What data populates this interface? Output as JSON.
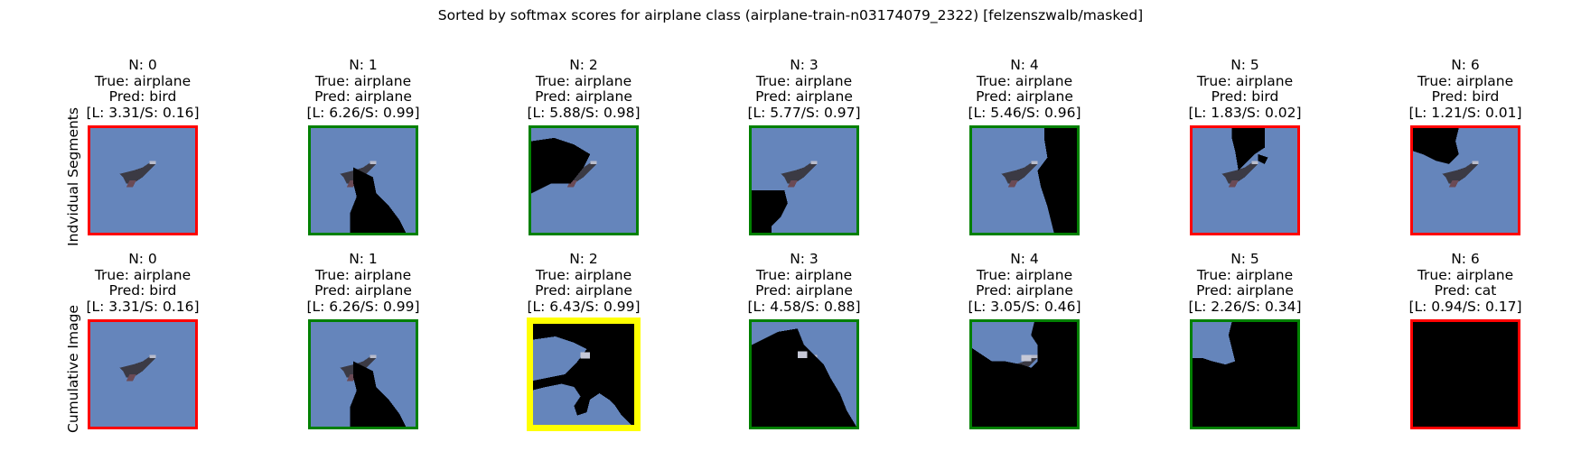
{
  "title": "Sorted by softmax scores for airplane class (airplane-train-n03174079_2322) [felzenszwalb/masked]",
  "row_labels": [
    "Indvidual Segments",
    "Cumulative Image"
  ],
  "colors": {
    "correct_border": "#008000",
    "incorrect_border": "#ff0000",
    "highlight_border": "#ffff00",
    "sky": "#6585bb",
    "mask": "#000000"
  },
  "chart_data": {
    "type": "image-grid",
    "rows": [
      {
        "label": "Indvidual Segments",
        "panels": [
          {
            "n": "N: 0",
            "true": "True: airplane",
            "pred": "Pred: bird",
            "score": "[L: 3.31/S: 0.16]",
            "correct": false
          },
          {
            "n": "N: 1",
            "true": "True: airplane",
            "pred": "Pred: airplane",
            "score": "[L: 6.26/S: 0.99]",
            "correct": true
          },
          {
            "n": "N: 2",
            "true": "True: airplane",
            "pred": "Pred: airplane",
            "score": "[L: 5.88/S: 0.98]",
            "correct": true
          },
          {
            "n": "N: 3",
            "true": "True: airplane",
            "pred": "Pred: airplane",
            "score": "[L: 5.77/S: 0.97]",
            "correct": true
          },
          {
            "n": "N: 4",
            "true": "True: airplane",
            "pred": "Pred: airplane",
            "score": "[L: 5.46/S: 0.96]",
            "correct": true
          },
          {
            "n": "N: 5",
            "true": "True: airplane",
            "pred": "Pred: bird",
            "score": "[L: 1.83/S: 0.02]",
            "correct": false
          },
          {
            "n": "N: 6",
            "true": "True: airplane",
            "pred": "Pred: bird",
            "score": "[L: 1.21/S: 0.01]",
            "correct": false
          }
        ]
      },
      {
        "label": "Cumulative Image",
        "panels": [
          {
            "n": "N: 0",
            "true": "True: airplane",
            "pred": "Pred: bird",
            "score": "[L: 3.31/S: 0.16]",
            "correct": false
          },
          {
            "n": "N: 1",
            "true": "True: airplane",
            "pred": "Pred: airplane",
            "score": "[L: 6.26/S: 0.99]",
            "correct": true
          },
          {
            "n": "N: 2",
            "true": "True: airplane",
            "pred": "Pred: airplane",
            "score": "[L: 6.43/S: 0.99]",
            "correct": true,
            "highlight": true
          },
          {
            "n": "N: 3",
            "true": "True: airplane",
            "pred": "Pred: airplane",
            "score": "[L: 4.58/S: 0.88]",
            "correct": true
          },
          {
            "n": "N: 4",
            "true": "True: airplane",
            "pred": "Pred: airplane",
            "score": "[L: 3.05/S: 0.46]",
            "correct": true
          },
          {
            "n": "N: 5",
            "true": "True: airplane",
            "pred": "Pred: airplane",
            "score": "[L: 2.26/S: 0.34]",
            "correct": true
          },
          {
            "n": "N: 6",
            "true": "True: airplane",
            "pred": "Pred: cat",
            "score": "[L: 0.94/S: 0.17]",
            "correct": false
          }
        ]
      }
    ]
  }
}
